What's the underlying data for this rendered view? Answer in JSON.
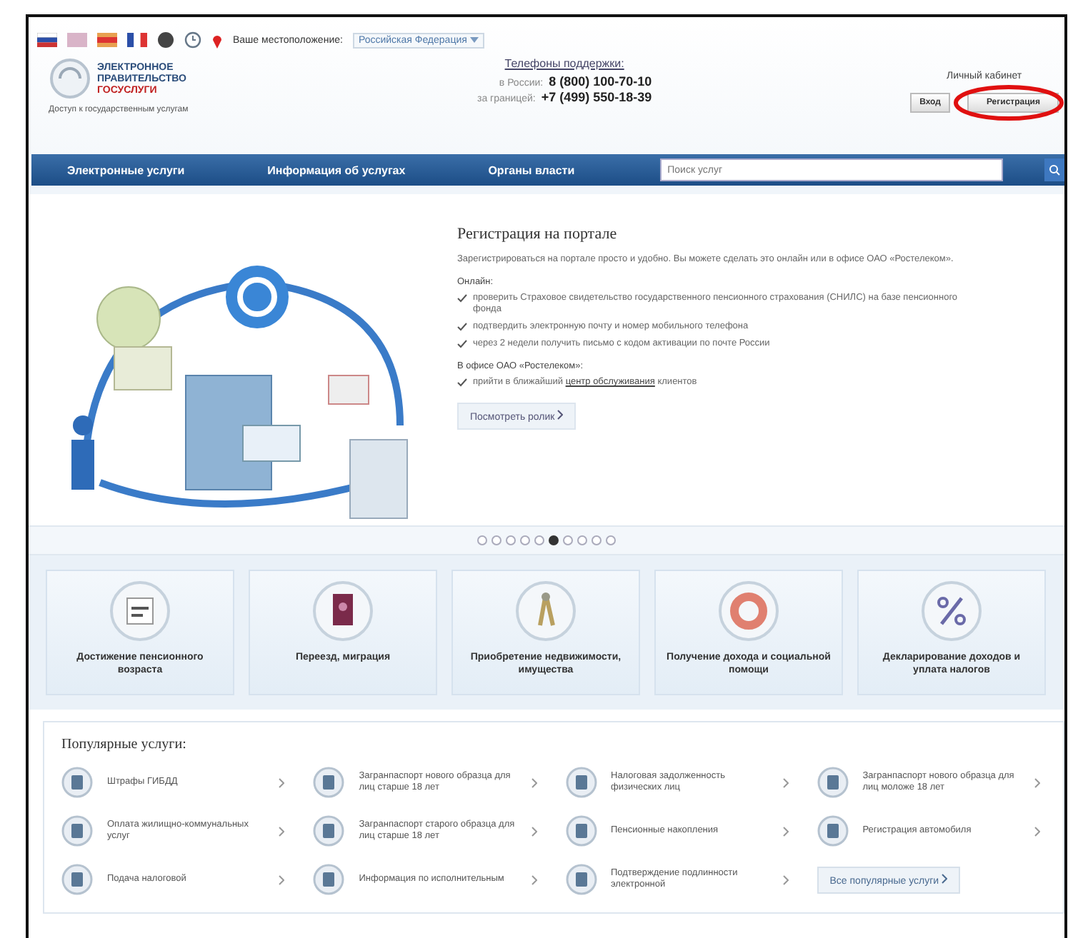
{
  "top_bar": {
    "location_label": "Ваше местоположение:",
    "location_value": "Российская Федерация"
  },
  "logo": {
    "lines": [
      "ЭЛЕКТРОННОЕ",
      "ПРАВИТЕЛЬСТВО"
    ],
    "brand": "ГОСУСЛУГИ",
    "tagline": "Доступ к государственным услугам"
  },
  "support": {
    "title": "Телефоны поддержки:",
    "phones": [
      {
        "label": "в России:",
        "number": "8 (800) 100-70-10"
      },
      {
        "label": "за границей:",
        "number": "+7 (499) 550-18-39"
      }
    ]
  },
  "account": {
    "title": "Личный кабинет",
    "login": "Вход",
    "register": "Регистрация",
    "register_circled": true
  },
  "nav": {
    "items": [
      "Электронные услуги",
      "Информация об услугах",
      "Органы власти"
    ],
    "search_placeholder": "Поиск услуг"
  },
  "slide": {
    "title": "Регистрация на портале",
    "intro": "Зарегистрироваться на портале просто и удобно. Вы можете сделать это онлайн или в офисе ОАО «Ростелеком».",
    "online_label": "Онлайн:",
    "online_steps": [
      "проверить Страховое свидетельство государственного пенсионного страхования (СНИЛС) на базе пенсионного фонда",
      "подтвердить электронную почту и номер мобильного телефона",
      "через 2 недели получить письмо с кодом активации по почте России"
    ],
    "office_label": "В офисе ОАО «Ростелеком»:",
    "office_step_before": "прийти в ближайший",
    "office_link": "центр обслуживания",
    "office_step_after": "клиентов",
    "button": "Посмотреть ролик"
  },
  "carousel": [
    {
      "selected": false
    },
    {
      "selected": false
    },
    {
      "selected": false
    },
    {
      "selected": false
    },
    {
      "selected": false
    },
    {
      "selected": true
    },
    {
      "selected": false
    },
    {
      "selected": false
    },
    {
      "selected": false
    },
    {
      "selected": false
    }
  ],
  "categories": [
    {
      "kind": "pension",
      "label": "Достижение пенсионного возраста"
    },
    {
      "kind": "passport",
      "label": "Переезд, миграция"
    },
    {
      "kind": "keys",
      "label": "Приобретение недвижимости, имущества"
    },
    {
      "kind": "lifebuoy",
      "label": "Получение дохода и социальной помощи"
    },
    {
      "kind": "percent",
      "label": "Декларирование доходов и уплата налогов"
    }
  ],
  "popular": {
    "title": "Популярные услуги:",
    "items": [
      {
        "label": "Штрафы ГИБДД"
      },
      {
        "label": "Загранпаспорт нового образца для лиц старше 18 лет"
      },
      {
        "label": "Налоговая задолженность физических лиц"
      },
      {
        "label": "Загранпаспорт нового образца для лиц моложе 18 лет"
      },
      {
        "label": "Оплата жилищно-коммунальных услуг"
      },
      {
        "label": "Загранпаспорт старого образца для лиц старше 18 лет"
      },
      {
        "label": "Пенсионные накопления"
      },
      {
        "label": "Регистрация автомобиля"
      },
      {
        "label": "Подача налоговой"
      },
      {
        "label": "Информация по исполнительным"
      },
      {
        "label": "Подтверждение подлинности электронной"
      }
    ],
    "all_button": "Все популярные услуги"
  }
}
